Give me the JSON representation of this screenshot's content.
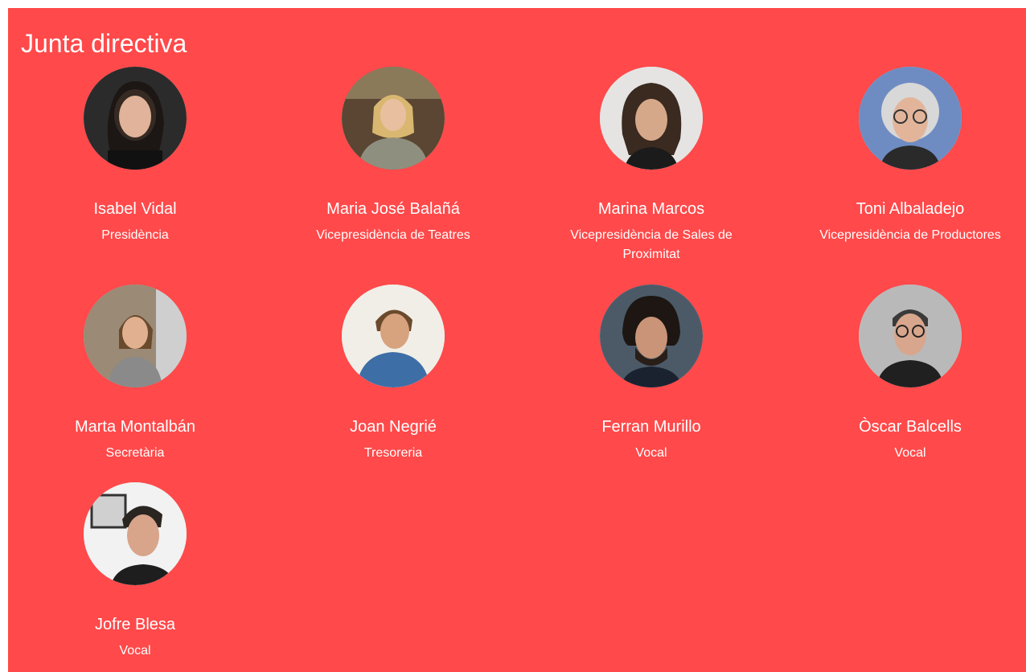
{
  "section": {
    "title": "Junta directiva"
  },
  "members": [
    {
      "name": "Isabel Vidal",
      "role": "Presidència"
    },
    {
      "name": "Maria José Balañá",
      "role": "Vicepresidència de Teatres"
    },
    {
      "name": "Marina Marcos",
      "role": "Vicepresidència de Sales de Proximitat"
    },
    {
      "name": "Toni Albaladejo",
      "role": "Vicepresidència de Productores"
    },
    {
      "name": "Marta Montalbán",
      "role": "Secretària"
    },
    {
      "name": "Joan Negrié",
      "role": "Tresoreria"
    },
    {
      "name": "Ferran Murillo",
      "role": "Vocal"
    },
    {
      "name": "Òscar Balcells",
      "role": "Vocal"
    },
    {
      "name": "Jofre Blesa",
      "role": "Vocal"
    }
  ],
  "colors": {
    "background": "#ff494a",
    "text": "#ffffff"
  }
}
